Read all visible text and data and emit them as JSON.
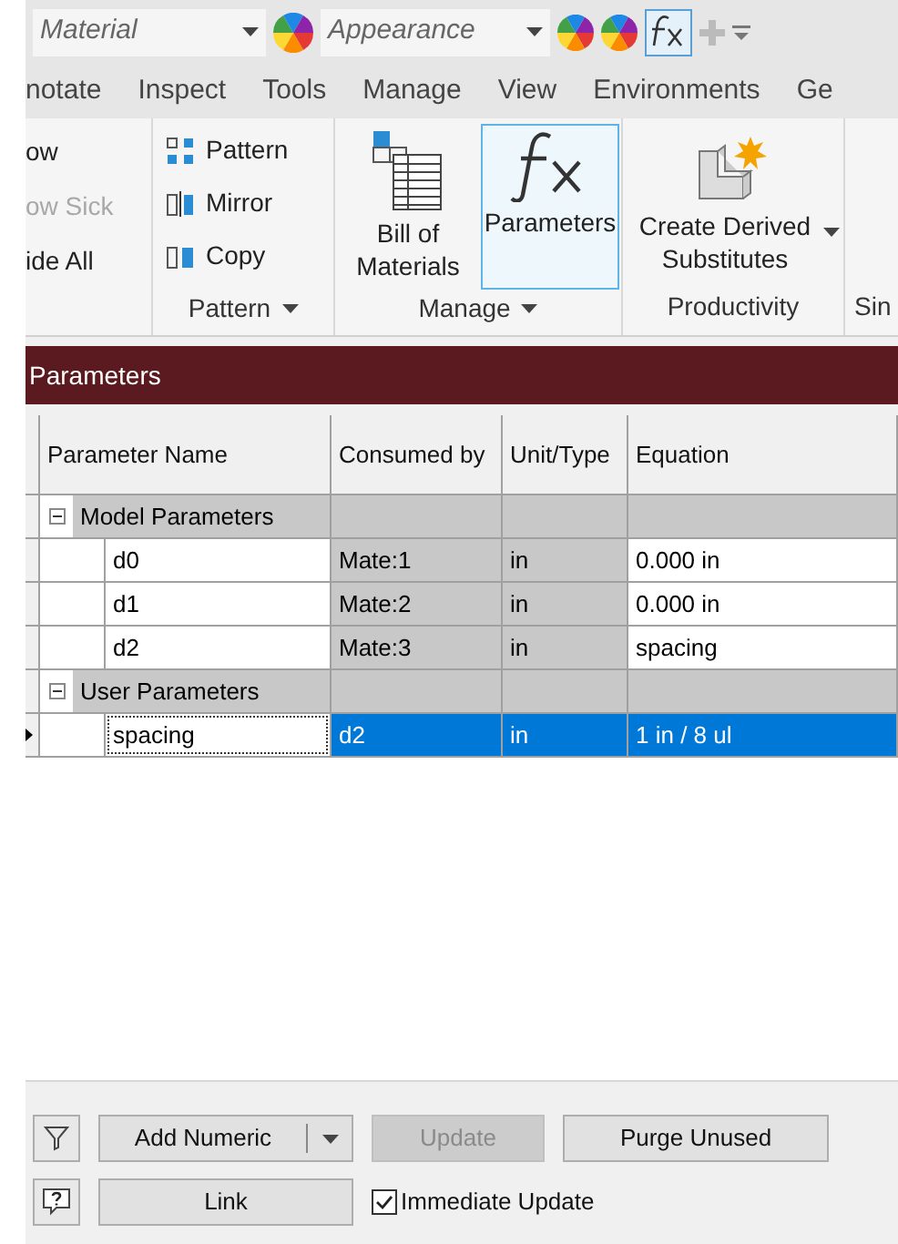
{
  "quick_access": {
    "material": "Material",
    "appearance": "Appearance"
  },
  "tabs": [
    {
      "label": "notate",
      "selected": false
    },
    {
      "label": "Inspect",
      "selected": false
    },
    {
      "label": "Tools",
      "selected": false
    },
    {
      "label": "Manage",
      "selected": false
    },
    {
      "label": "View",
      "selected": false
    },
    {
      "label": "Environments",
      "selected": false
    },
    {
      "label": "Ge",
      "selected": false
    }
  ],
  "ribbon": {
    "visibility_panel": {
      "items": [
        {
          "label": "ow",
          "disabled": false
        },
        {
          "label": "ow Sick",
          "disabled": true
        },
        {
          "label": "ide All",
          "disabled": false
        }
      ]
    },
    "pattern_panel": {
      "items": [
        {
          "label": "Pattern",
          "kind": "pattern"
        },
        {
          "label": "Mirror",
          "kind": "mirror"
        },
        {
          "label": "Copy",
          "kind": "copy"
        }
      ],
      "footer": "Pattern"
    },
    "manage_panel": {
      "items": [
        {
          "label": "Bill of Materials",
          "kind": "bom",
          "selected": false
        },
        {
          "label": "Parameters",
          "kind": "fx",
          "selected": true
        }
      ],
      "footer": "Manage"
    },
    "productivity_panel": {
      "item": "Create Derived Substitutes",
      "footer": "Productivity"
    },
    "next_panel_footer": "Sin"
  },
  "dialog": {
    "title": "Parameters",
    "table": {
      "columns": [
        "Parameter Name",
        "Consumed by",
        "Unit/Type",
        "Equation"
      ],
      "groups": [
        {
          "name": "Model Parameters",
          "expanded": true,
          "children": [
            {
              "name": "d0",
              "consumed_by": "Mate:1",
              "unit": "in",
              "equation": "0.000 in",
              "selected": false
            },
            {
              "name": "d1",
              "consumed_by": "Mate:2",
              "unit": "in",
              "equation": "0.000 in",
              "selected": false
            },
            {
              "name": "d2",
              "consumed_by": "Mate:3",
              "unit": "in",
              "equation": "spacing",
              "selected": false
            }
          ]
        },
        {
          "name": "User Parameters",
          "expanded": true,
          "children": [
            {
              "name": "spacing",
              "consumed_by": "d2",
              "unit": "in",
              "equation": "1 in / 8 ul",
              "selected": true
            }
          ]
        }
      ]
    },
    "buttons": {
      "add_numeric": "Add Numeric",
      "update": {
        "label": "Update",
        "disabled": true
      },
      "purge": "Purge Unused",
      "link": "Link",
      "immediate_update": {
        "label": "Immediate Update",
        "checked": true
      }
    }
  }
}
